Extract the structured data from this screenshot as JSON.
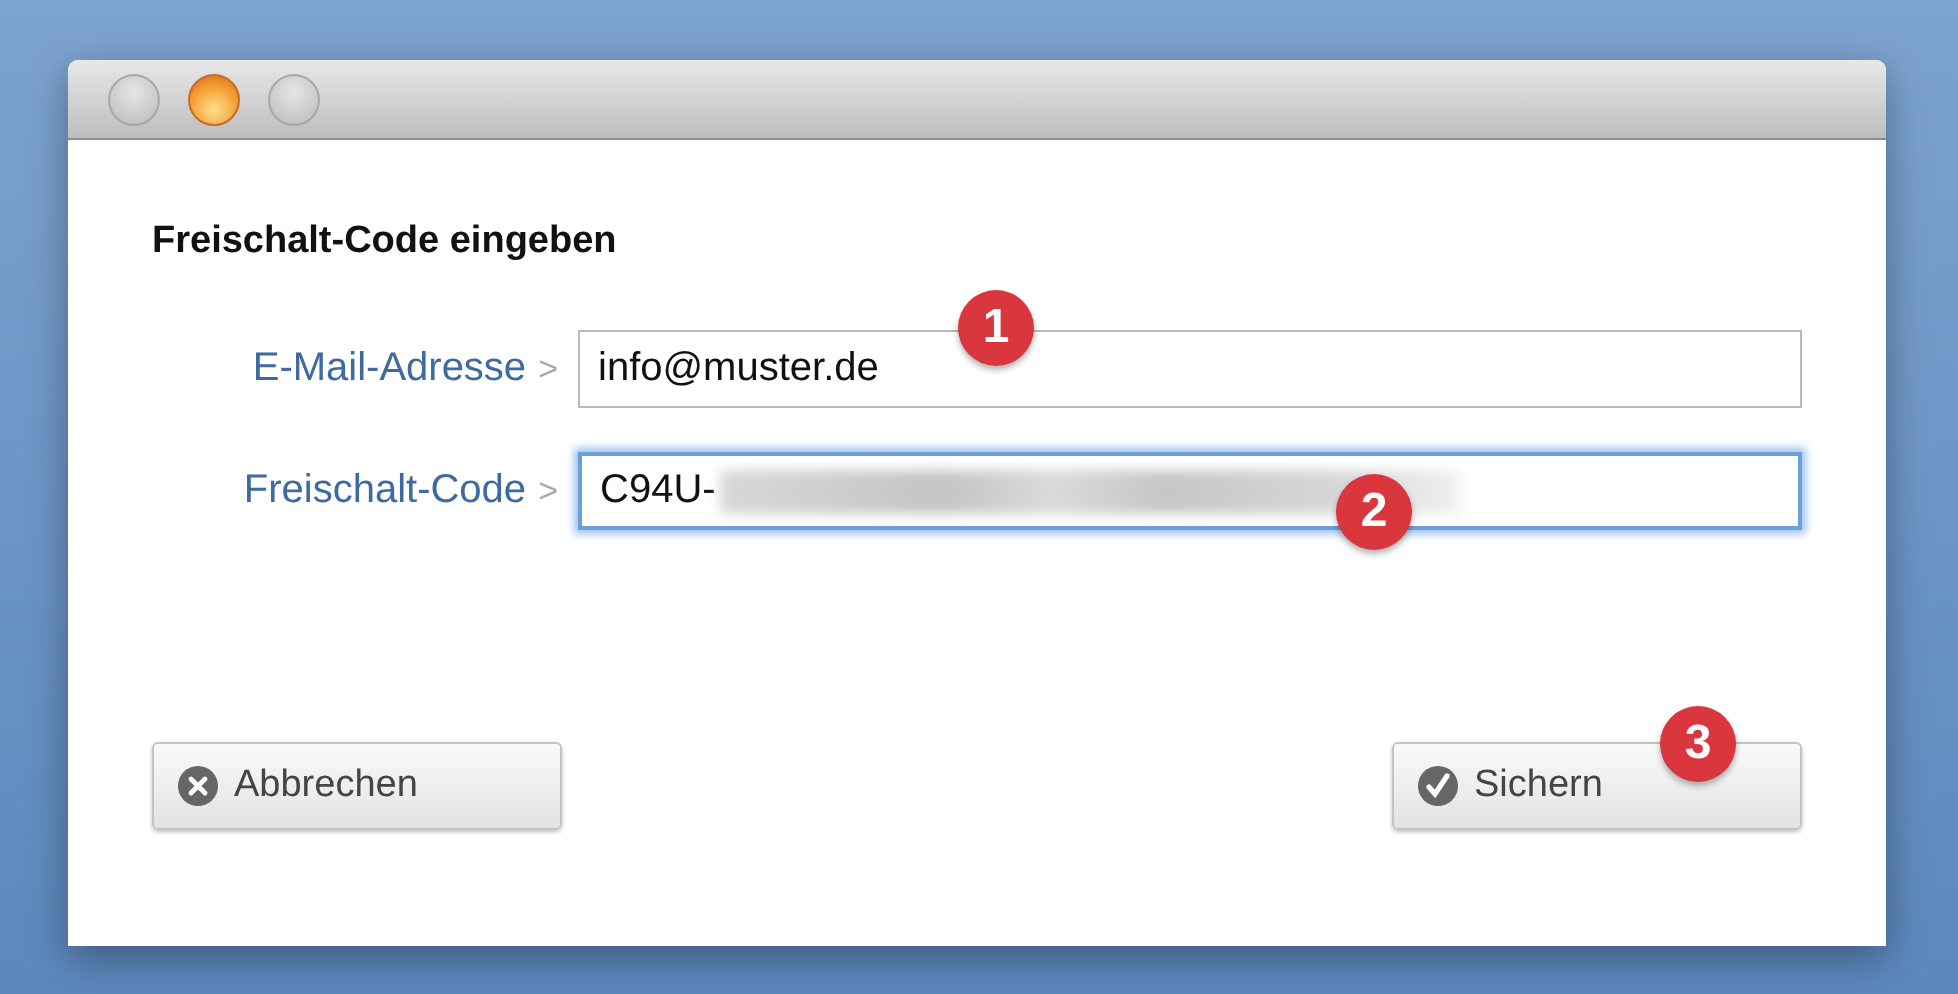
{
  "dialog": {
    "heading": "Freischalt-Code eingeben"
  },
  "fields": [
    {
      "label": "E-Mail-Adresse",
      "separator": ">",
      "value": "info@muster.de",
      "focused": false,
      "badge": "1"
    },
    {
      "label": "Freischalt-Code",
      "separator": ">",
      "value": "C94U-",
      "focused": true,
      "redacted": true,
      "badge": "2"
    }
  ],
  "buttons": [
    {
      "label": "Abbrechen",
      "kind": "cancel"
    },
    {
      "label": "Sichern",
      "kind": "save",
      "badge": "3"
    }
  ]
}
